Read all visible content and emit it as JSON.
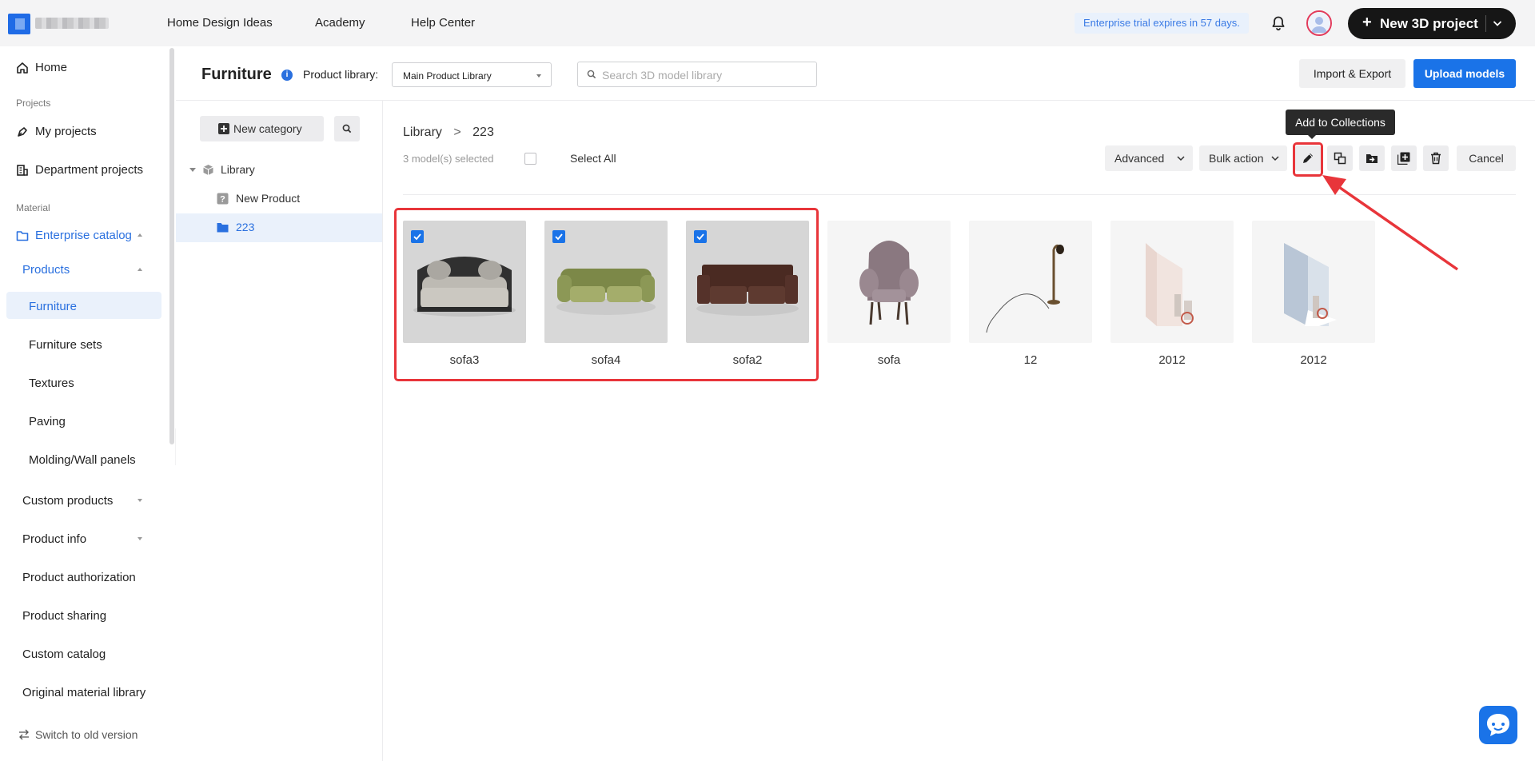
{
  "topbar": {
    "nav": [
      "Home Design Ideas",
      "Academy",
      "Help Center"
    ],
    "trial_notice": "Enterprise trial expires in 57 days.",
    "new_project_label": "New 3D project"
  },
  "sidebar": {
    "home": "Home",
    "section_projects": "Projects",
    "my_projects": "My projects",
    "department_projects": "Department projects",
    "section_material": "Material",
    "enterprise_catalog": "Enterprise catalog",
    "products": "Products",
    "furniture": "Furniture",
    "furniture_sets": "Furniture sets",
    "textures": "Textures",
    "paving": "Paving",
    "molding": "Molding/Wall panels",
    "custom_products": "Custom products",
    "product_info": "Product info",
    "product_authorization": "Product authorization",
    "product_sharing": "Product sharing",
    "custom_catalog": "Custom catalog",
    "original_material_library": "Original material library",
    "switch_old": "Switch to old version"
  },
  "header": {
    "title": "Furniture",
    "info_glyph": "i",
    "library_label": "Product library:",
    "library_value": "Main Product Library",
    "search_placeholder": "Search 3D model library",
    "import_export": "Import & Export",
    "upload": "Upload models"
  },
  "category_panel": {
    "new_category": "New category",
    "tree": [
      {
        "label": "Library",
        "selected": false
      },
      {
        "label": "New Product",
        "selected": false
      },
      {
        "label": "223",
        "selected": true
      }
    ]
  },
  "toolbar": {
    "breadcrumb_root": "Library",
    "breadcrumb_sep": ">",
    "breadcrumb_current": "223",
    "selected_count": "3 model(s) selected",
    "select_all": "Select All",
    "advanced": "Advanced",
    "bulk_action": "Bulk action",
    "tooltip": "Add to Collections",
    "cancel": "Cancel",
    "icons": [
      "pencil-icon",
      "copy-icon",
      "move-icon",
      "add-collection-icon",
      "trash-icon"
    ]
  },
  "models": [
    {
      "name": "sofa3",
      "checked": true
    },
    {
      "name": "sofa4",
      "checked": true
    },
    {
      "name": "sofa2",
      "checked": true
    },
    {
      "name": "sofa",
      "checked": false
    },
    {
      "name": "12",
      "checked": false
    },
    {
      "name": "2012",
      "checked": false
    },
    {
      "name": "2012",
      "checked": false
    }
  ],
  "colors": {
    "accent": "#1a73e8",
    "annotation": "#e8353a",
    "selected_bg": "#eaf1fb"
  }
}
